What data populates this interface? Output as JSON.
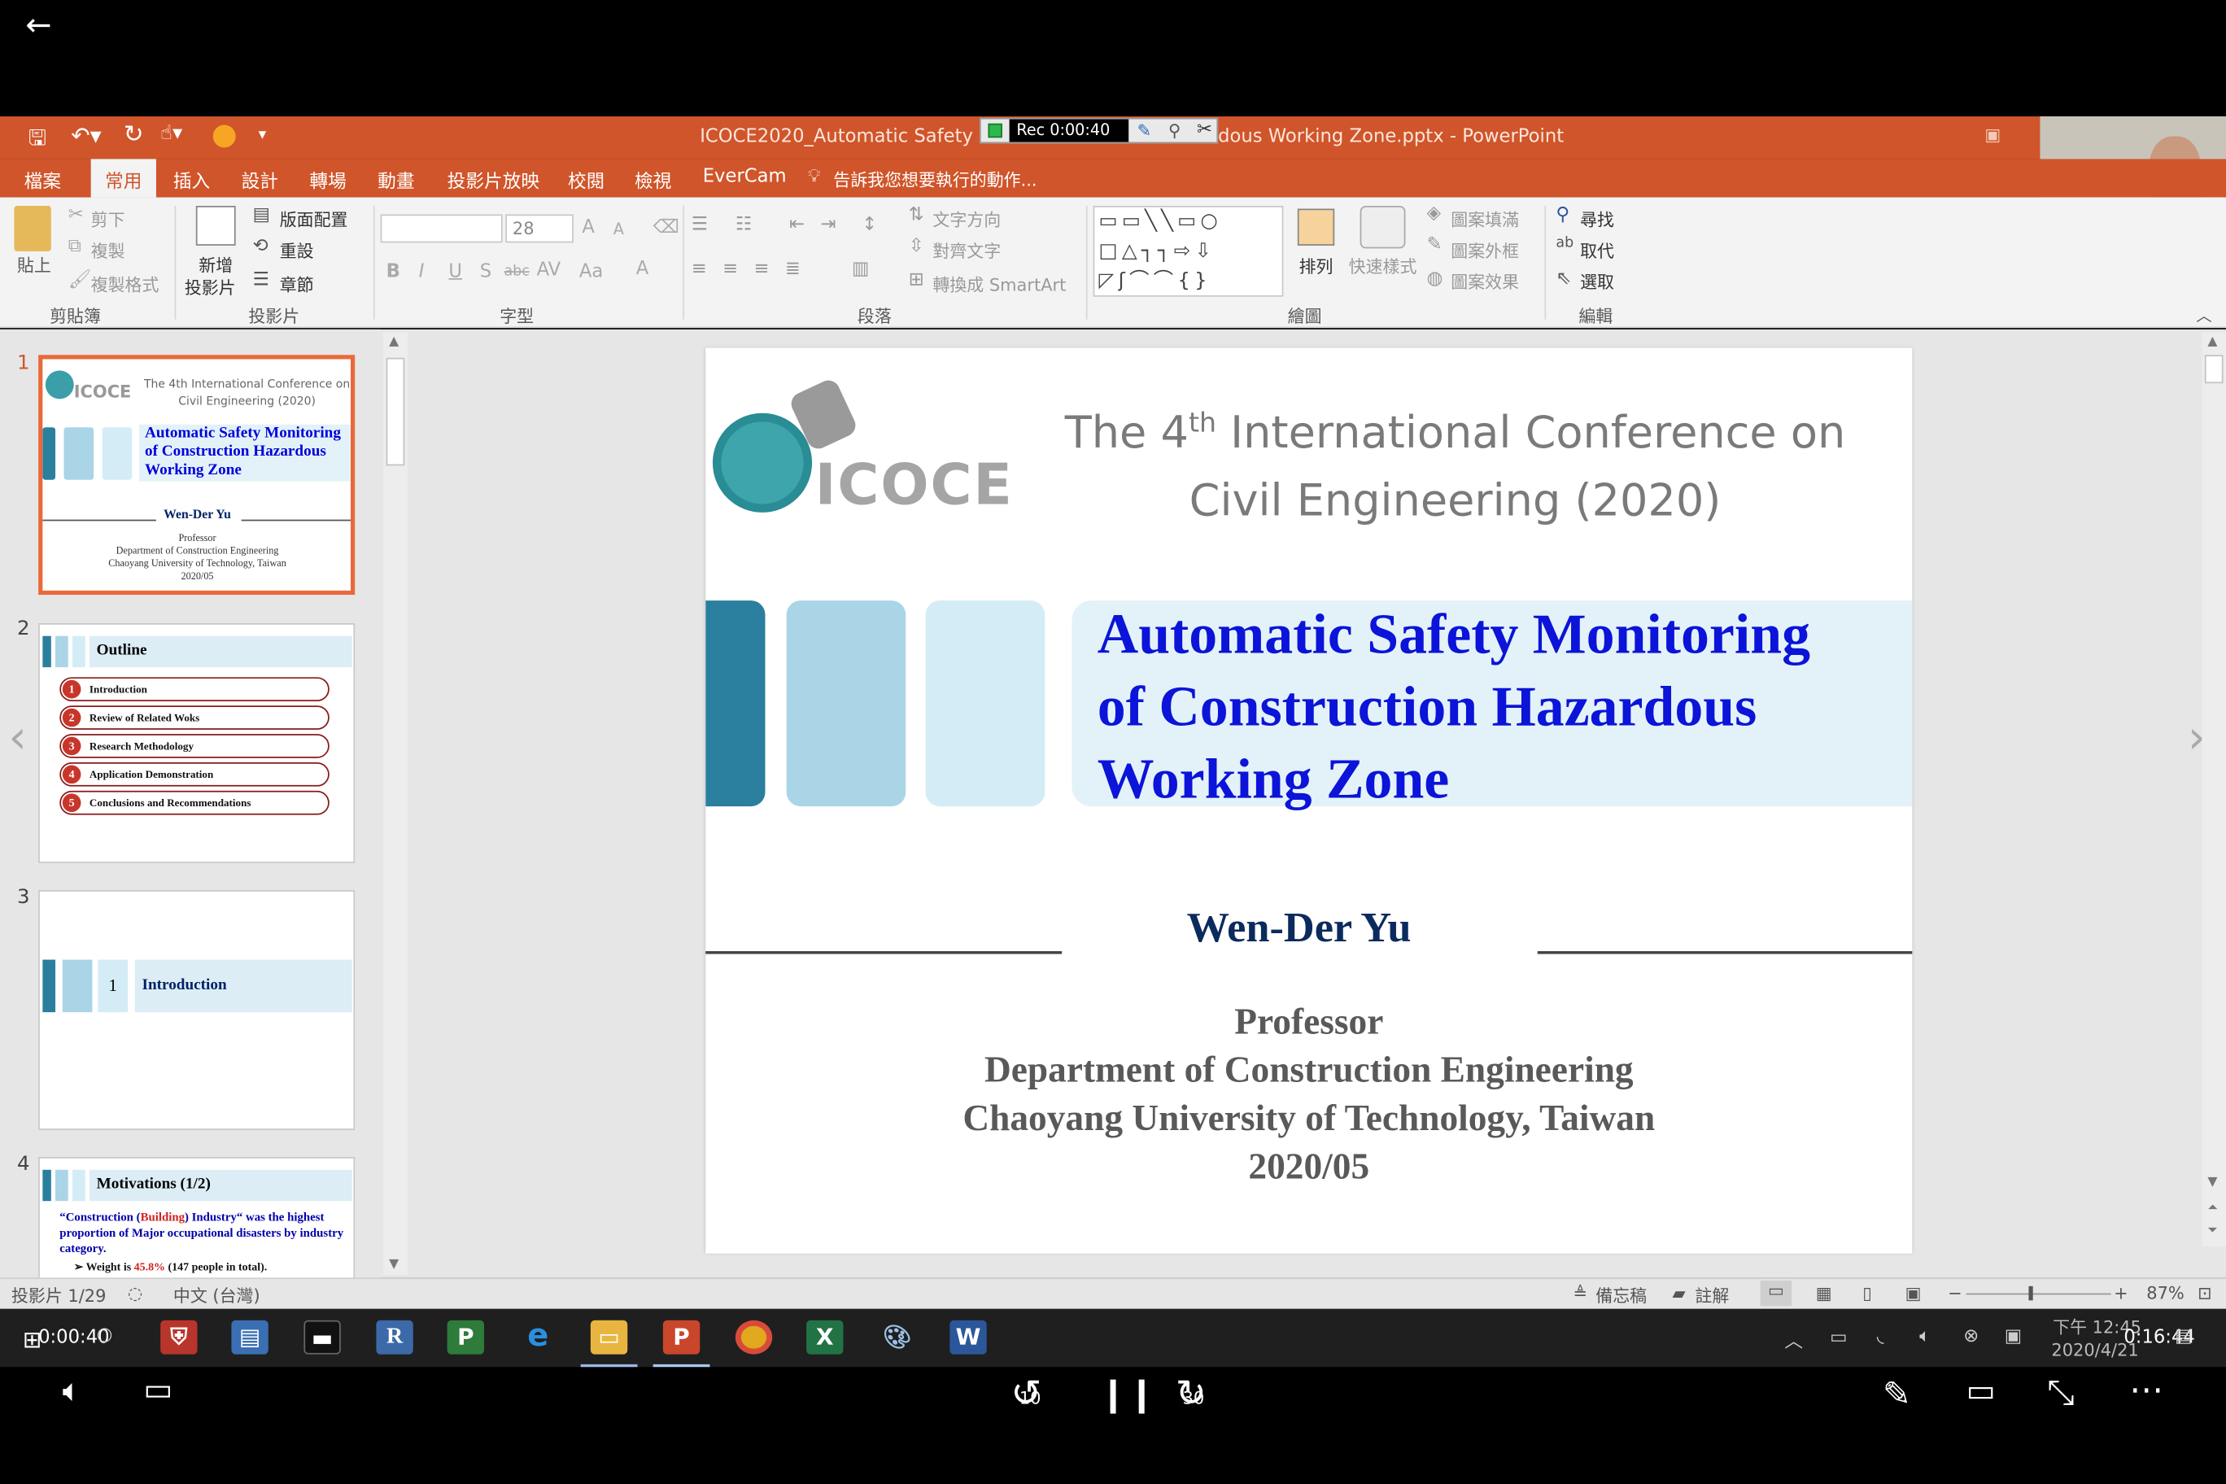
{
  "window": {
    "title": "ICOCE2020_Automatic Safety Mon",
    "title_tail": "dous Working Zone.pptx - PowerPoint"
  },
  "recorder": {
    "time": "Rec 0:00:40"
  },
  "ribbon_tabs": [
    "檔案",
    "常用",
    "插入",
    "設計",
    "轉場",
    "動畫",
    "投影片放映",
    "校閱",
    "檢視",
    "EverCam"
  ],
  "tell_me": "告訴我您想要執行的動作...",
  "ribbon": {
    "clipboard": {
      "paste": "貼上",
      "cut": "剪下",
      "copy": "複製",
      "format_painter": "複製格式",
      "label": "剪貼簿"
    },
    "slides": {
      "new_slide_1": "新增",
      "new_slide_2": "投影片",
      "layout": "版面配置",
      "reset": "重設",
      "section": "章節",
      "label": "投影片"
    },
    "font": {
      "size": "28",
      "label": "字型"
    },
    "paragraph": {
      "text_direction": "文字方向",
      "align_text": "對齊文字",
      "convert_smartart": "轉換成 SmartArt",
      "label": "段落"
    },
    "drawing": {
      "arrange": "排列",
      "quick_styles": "快速樣式",
      "shape_fill": "圖案填滿",
      "shape_outline": "圖案外框",
      "shape_effects": "圖案效果",
      "label": "繪圖"
    },
    "editing": {
      "find": "尋找",
      "replace": "取代",
      "select": "選取",
      "label": "編輯"
    }
  },
  "thumbnails": [
    {
      "num": "1",
      "conf": "The 4th International Conference on Civil Engineering (2020)",
      "title": "Automatic Safety Monitoring of Construction Hazardous Working Zone",
      "author": "Wen-Der Yu",
      "role": "Professor",
      "dept": "Department of Construction Engineering",
      "univ": "Chaoyang University of Technology, Taiwan",
      "date": "2020/05"
    },
    {
      "num": "2",
      "title": "Outline",
      "items": [
        {
          "n": "1",
          "t": "Introduction"
        },
        {
          "n": "2",
          "t": "Review of Related Woks"
        },
        {
          "n": "3",
          "t": "Research Methodology"
        },
        {
          "n": "4",
          "t": "Application Demonstration"
        },
        {
          "n": "5",
          "t": "Conclusions and Recommendations"
        }
      ]
    },
    {
      "num": "3",
      "section_num": "1",
      "title": "Introduction"
    },
    {
      "num": "4",
      "title": "Motivations (1/2)",
      "q_open": "“Construction (",
      "q_red": "Building",
      "q_mid": ") Industry“ was the highest proportion of Major occupational disasters by industry category.",
      "bullet_pre": "Weight is ",
      "bullet_red": "45.8%",
      "bullet_post": " (147 people in total)."
    }
  ],
  "slide": {
    "conf_line1_pre": "The 4",
    "conf_sup": "th",
    "conf_line1_post": " International Conference on",
    "conf_line2": "Civil Engineering (2020)",
    "logo_text": "ICOCE",
    "title_l1": "Automatic Safety Monitoring",
    "title_l2": "of Construction Hazardous",
    "title_l3": "Working Zone",
    "author": "Wen-Der Yu",
    "role": "Professor",
    "dept": "Department of Construction Engineering",
    "univ": "Chaoyang University of Technology, Taiwan",
    "date": "2020/05"
  },
  "status": {
    "slide_info": "投影片 1/29",
    "language": "中文 (台灣)",
    "notes": "備忘稿",
    "comments": "註解",
    "zoom": "87%",
    "zoom_level": 0.87
  },
  "taskbar": {
    "time": "下午 12:45",
    "date": "2020/4/21",
    "rec_elapsed": "0:00:40",
    "duration": "0:16:44"
  },
  "player": {
    "back10": "10",
    "fwd30": "30"
  }
}
